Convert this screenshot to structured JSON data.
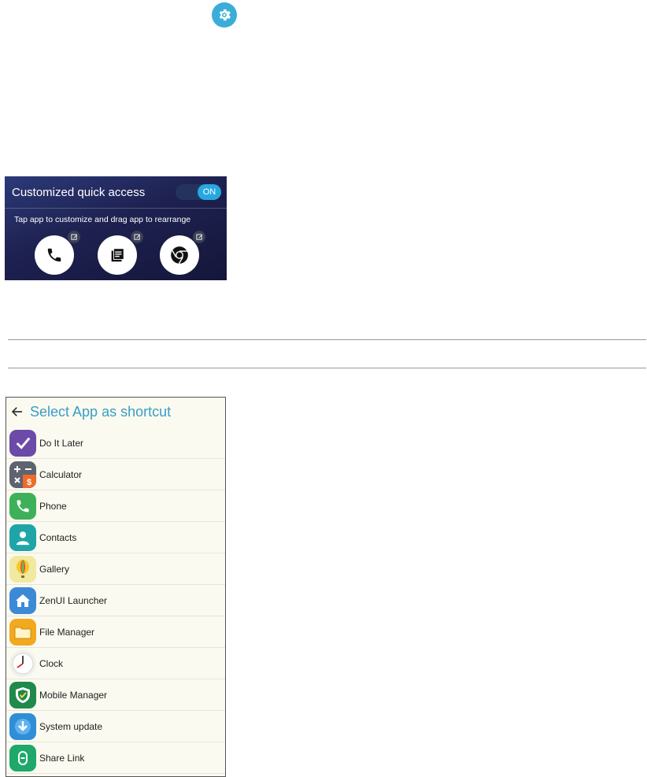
{
  "settings_icon": "gear-icon",
  "quick_access": {
    "title": "Customized quick access",
    "toggle_label": "ON",
    "subtitle": "Tap app to customize and drag app to rearrange",
    "apps": [
      {
        "icon": "phone-icon"
      },
      {
        "icon": "notes-icon"
      },
      {
        "icon": "chrome-icon"
      }
    ],
    "edit_icon": "edit-icon"
  },
  "app_picker": {
    "title": "Select App as shortcut",
    "back_icon": "back-arrow-icon",
    "items": [
      {
        "label": "Do It Later",
        "icon": "check-icon",
        "color": "#6b4aa8"
      },
      {
        "label": "Calculator",
        "icon": "calculator-icon",
        "color": "#5d6470"
      },
      {
        "label": "Phone",
        "icon": "phone-icon",
        "color": "#3fb05a"
      },
      {
        "label": "Contacts",
        "icon": "person-icon",
        "color": "#1fa5a8"
      },
      {
        "label": "Gallery",
        "icon": "balloon-icon",
        "color": "#f2e9a0"
      },
      {
        "label": "ZenUI Launcher",
        "icon": "home-icon",
        "color": "#3c8ad6"
      },
      {
        "label": "File Manager",
        "icon": "folder-icon",
        "color": "#f3a81e"
      },
      {
        "label": "Clock",
        "icon": "clock-icon",
        "color": "#f0f0ec"
      },
      {
        "label": "Mobile Manager",
        "icon": "shield-icon",
        "color": "#1f8a4a"
      },
      {
        "label": "System update",
        "icon": "download-icon",
        "color": "#2f8fd6"
      },
      {
        "label": "Share Link",
        "icon": "share-link-icon",
        "color": "#1ea86a"
      }
    ]
  }
}
